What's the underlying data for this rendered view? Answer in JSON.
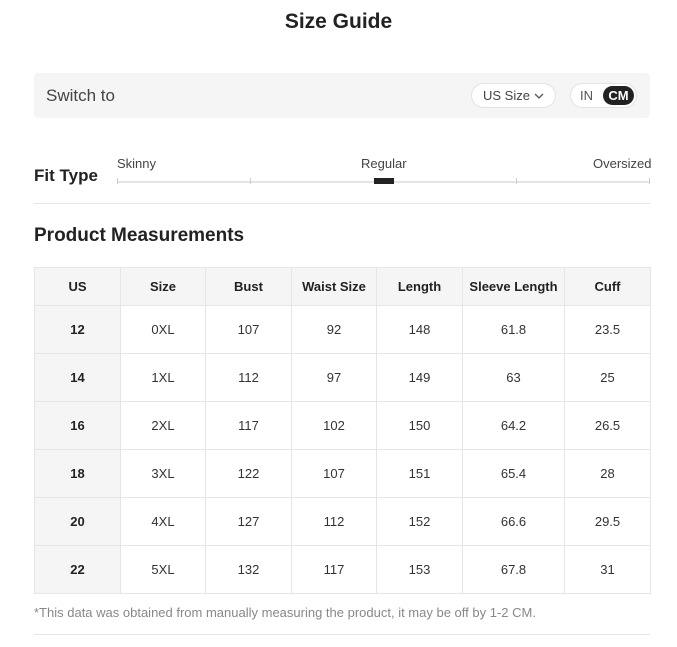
{
  "title": "Size Guide",
  "switch": {
    "label": "Switch to",
    "size_system": "US Size",
    "units": [
      "IN",
      "CM"
    ],
    "selected_unit": "CM"
  },
  "fit": {
    "label": "Fit Type",
    "options": [
      "Skinny",
      "Regular",
      "Oversized"
    ],
    "selected": "Regular"
  },
  "measurements": {
    "title": "Product Measurements",
    "columns": [
      "US",
      "Size",
      "Bust",
      "Waist Size",
      "Length",
      "Sleeve Length",
      "Cuff"
    ],
    "rows": [
      [
        "12",
        "0XL",
        "107",
        "92",
        "148",
        "61.8",
        "23.5"
      ],
      [
        "14",
        "1XL",
        "112",
        "97",
        "149",
        "63",
        "25"
      ],
      [
        "16",
        "2XL",
        "117",
        "102",
        "150",
        "64.2",
        "26.5"
      ],
      [
        "18",
        "3XL",
        "122",
        "107",
        "151",
        "65.4",
        "28"
      ],
      [
        "20",
        "4XL",
        "127",
        "112",
        "152",
        "66.6",
        "29.5"
      ],
      [
        "22",
        "5XL",
        "132",
        "117",
        "153",
        "67.8",
        "31"
      ]
    ]
  },
  "note": "*This data was obtained from manually measuring the product, it may be off by 1-2 CM.",
  "colors": {
    "accent": "#222222",
    "panel_bg": "#f5f5f5",
    "border": "#e6e6e6",
    "muted_text": "#888888"
  }
}
